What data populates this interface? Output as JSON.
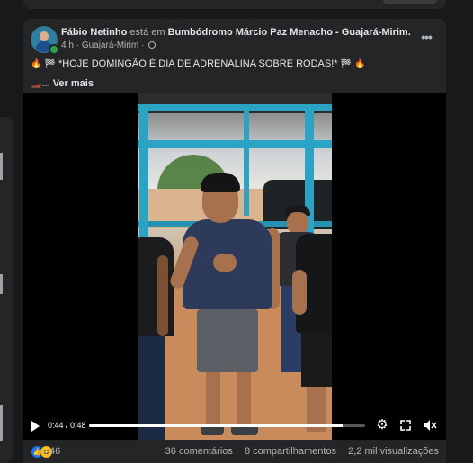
{
  "post": {
    "author": "Fábio Netinho",
    "is_at": "está em",
    "place": "Bumbódromo Márcio Paz Menacho - Guajará-Mirim.",
    "time": "4 h",
    "location": "Guajará-Mirim",
    "separator": "·",
    "more_label": "•••",
    "text": "*HOJE DOMINGÃO É DIA DE ADRENALINA SOBRE RODAS!*",
    "ellipsis": "...",
    "see_more": "Ver mais",
    "emoji": {
      "fire": "🔥",
      "flag": "🏁",
      "car": "🏎️"
    }
  },
  "video": {
    "current_time": "0:44",
    "time_separator": " / ",
    "duration": "0:48",
    "progress_fraction": 0.917
  },
  "footer": {
    "reaction_count": "46",
    "comments": "36 comentários",
    "shares": "8 compartilhamentos",
    "views": "2,2 mil visualizações"
  },
  "icons": {
    "more": "more-options-icon",
    "globe": "globe-icon",
    "play": "play-icon",
    "settings": "gear-icon",
    "fullscreen": "expand-icon",
    "volume": "volume-icon",
    "like": "like-icon",
    "haha": "haha-icon"
  },
  "colors": {
    "background": "#18191a",
    "card": "#242526",
    "primary_text": "#e4e6eb",
    "secondary_text": "#b0b3b8",
    "like_blue": "#1877f2",
    "online_green": "#31a24c"
  }
}
